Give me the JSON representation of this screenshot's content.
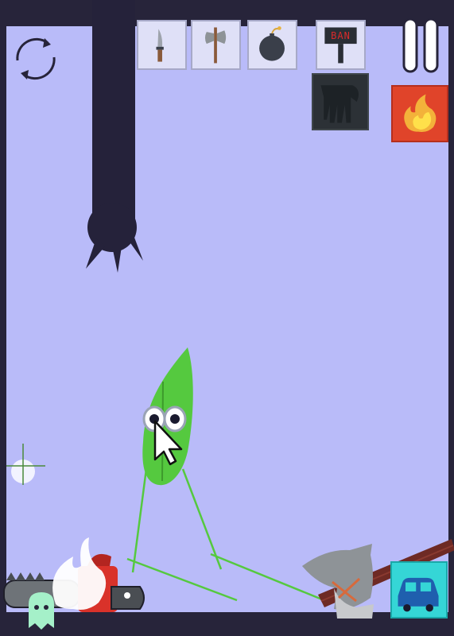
{
  "game": {
    "toolbar": {
      "slots": [
        {
          "tool": "knife",
          "icon": "knife-icon"
        },
        {
          "tool": "axe",
          "icon": "axe-icon"
        },
        {
          "tool": "bomb",
          "icon": "bomb-icon"
        },
        {
          "tool": "ban-hammer",
          "icon": "ban-hammer-icon",
          "label": "BAN"
        }
      ],
      "extra_tools": [
        {
          "tool": "grab-hand",
          "icon": "grab-hand-icon"
        },
        {
          "tool": "fire",
          "icon": "fire-icon"
        },
        {
          "tool": "car",
          "icon": "car-icon"
        }
      ]
    },
    "controls": {
      "pause_icon": "pause-icon",
      "restart_icon": "restart-icon"
    },
    "colors": {
      "frame": "#27243a",
      "background": "#b9bbf9",
      "leaf_character": "#55c93f",
      "fire_tile": "#e0442a",
      "car_tile": "#35d6d6"
    }
  }
}
